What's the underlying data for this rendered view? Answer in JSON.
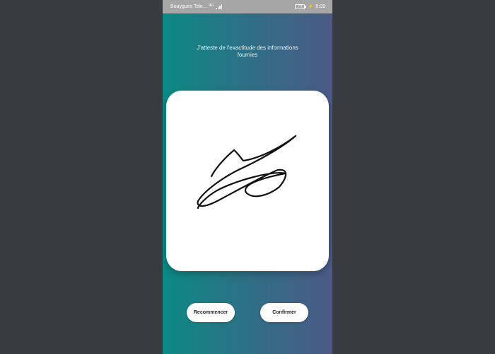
{
  "status_bar": {
    "carrier": "Bouygues Tele...",
    "network_type": "4G",
    "battery_level": "79",
    "time": "5:09",
    "icons": [
      "signal-icon",
      "battery-icon",
      "charging-bolt-icon"
    ]
  },
  "attestation": {
    "text": "J'atteste de l'exactitude des informations fournies"
  },
  "signature_pad": {
    "background": "#ffffff",
    "stroke_color": "#111111"
  },
  "actions": {
    "restart_label": "Recommencer",
    "confirm_label": "Confirmer"
  },
  "colors": {
    "gradient_start": "#0b8a84",
    "gradient_end": "#4b5a86",
    "page_background": "#383b40",
    "status_bar": "#a6a6a6"
  }
}
